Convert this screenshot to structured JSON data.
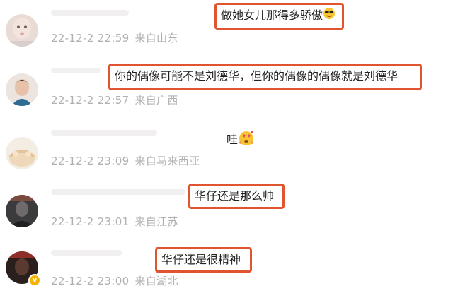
{
  "comments": [
    {
      "text": "做她女儿那得多骄傲",
      "emoji": "sunglasses-emoji",
      "date": "22-12-2 22:59",
      "location": "来自山东"
    },
    {
      "text": "你的偶像可能不是刘德华，但你的偶像的偶像就是刘德华",
      "date": "22-12-2 22:57",
      "location": "来自广西"
    },
    {
      "text": "哇",
      "emoji": "heart-eyes-emoji",
      "date": "22-12-2 23:09",
      "location": "来自马来西亚"
    },
    {
      "text": "华仔还是那么帅",
      "date": "22-12-2 23:01",
      "location": "来自江苏"
    },
    {
      "text": "华仔还是很精神",
      "date": "22-12-2 23:00",
      "location": "来自湖北",
      "verified_badge": "v"
    }
  ],
  "colors": {
    "highlight_border": "#e0552f",
    "meta_text": "#b0b0b0",
    "body_text": "#222222"
  }
}
